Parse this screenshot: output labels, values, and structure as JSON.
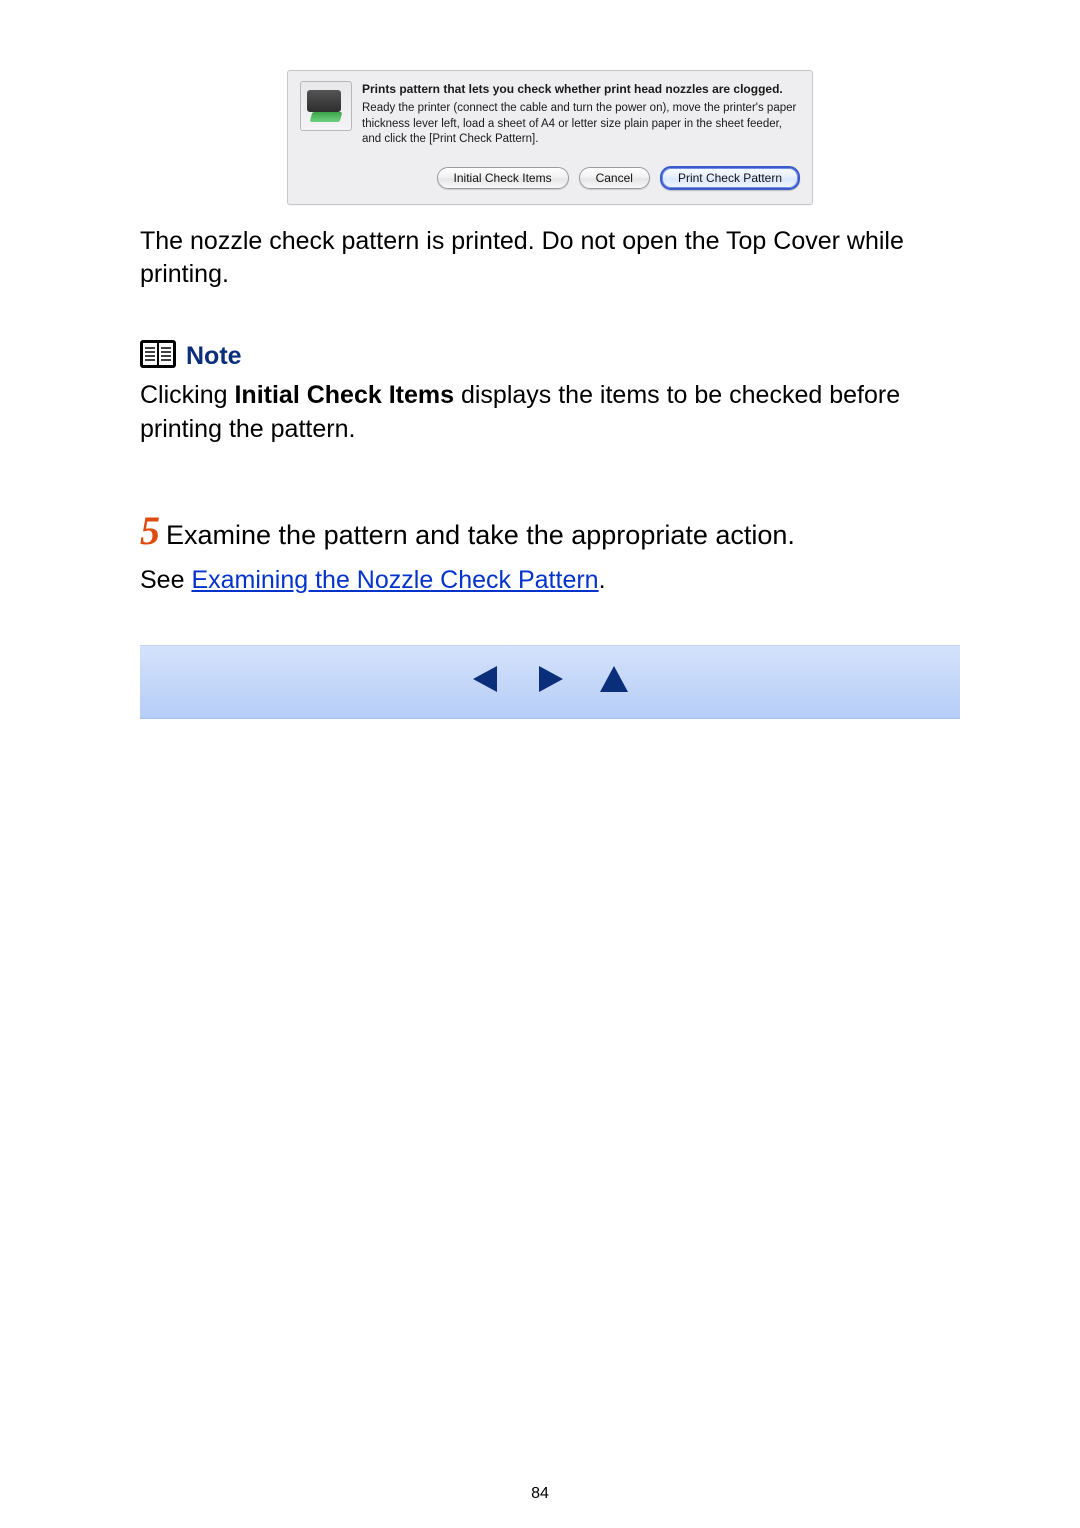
{
  "dialog": {
    "icon_name": "printer-photo-icon",
    "title": "Prints pattern that lets you check whether print head nozzles are clogged.",
    "body": "Ready the printer (connect the cable and turn the power on), move the printer's paper thickness lever left, load a sheet of A4 or letter size plain paper in the sheet feeder, and click the [Print Check Pattern].",
    "buttons": {
      "initial_check": "Initial Check Items",
      "cancel": "Cancel",
      "print_check": "Print Check Pattern"
    }
  },
  "body_text": "The nozzle check pattern is printed. Do not open the Top Cover while printing.",
  "note": {
    "label": "Note",
    "body_prefix": "Clicking ",
    "body_bold": "Initial Check Items",
    "body_suffix": " displays the items to be checked before printing the pattern."
  },
  "step": {
    "number": "5",
    "text": "Examine the pattern and take the appropriate action."
  },
  "see": {
    "prefix": "See ",
    "link": "Examining the Nozzle Check Pattern",
    "suffix": "."
  },
  "nav": {
    "prev": "previous",
    "next": "next",
    "top": "top"
  },
  "page_number": "84",
  "colors": {
    "note_heading": "#0a2e7a",
    "step_number": "#de4a0f",
    "link": "#0433cc",
    "nav_bg_top": "#d4e2fb",
    "nav_bg_bottom": "#b6cdf7",
    "nav_arrow": "#0a2e7a"
  }
}
